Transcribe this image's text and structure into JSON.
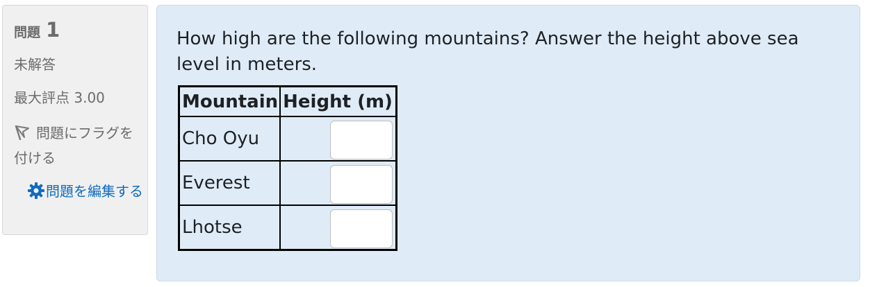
{
  "info": {
    "question_label": "問題",
    "question_number": "1",
    "state": "未解答",
    "max_grade": "最大評点 3.00",
    "flag_text": "問題にフラグを付ける",
    "edit_text": "問題を編集する"
  },
  "question": {
    "text": "How high are the following mountains? Answer the height above sea level in meters.",
    "table": {
      "headers": [
        "Mountain",
        "Height (m)"
      ],
      "rows": [
        {
          "mountain": "Cho Oyu",
          "value": ""
        },
        {
          "mountain": "Everest",
          "value": ""
        },
        {
          "mountain": "Lhotse",
          "value": ""
        }
      ]
    }
  },
  "colors": {
    "link": "#0f6cbf",
    "content_bg": "#dfebf6",
    "info_bg": "#f0f0f0"
  }
}
